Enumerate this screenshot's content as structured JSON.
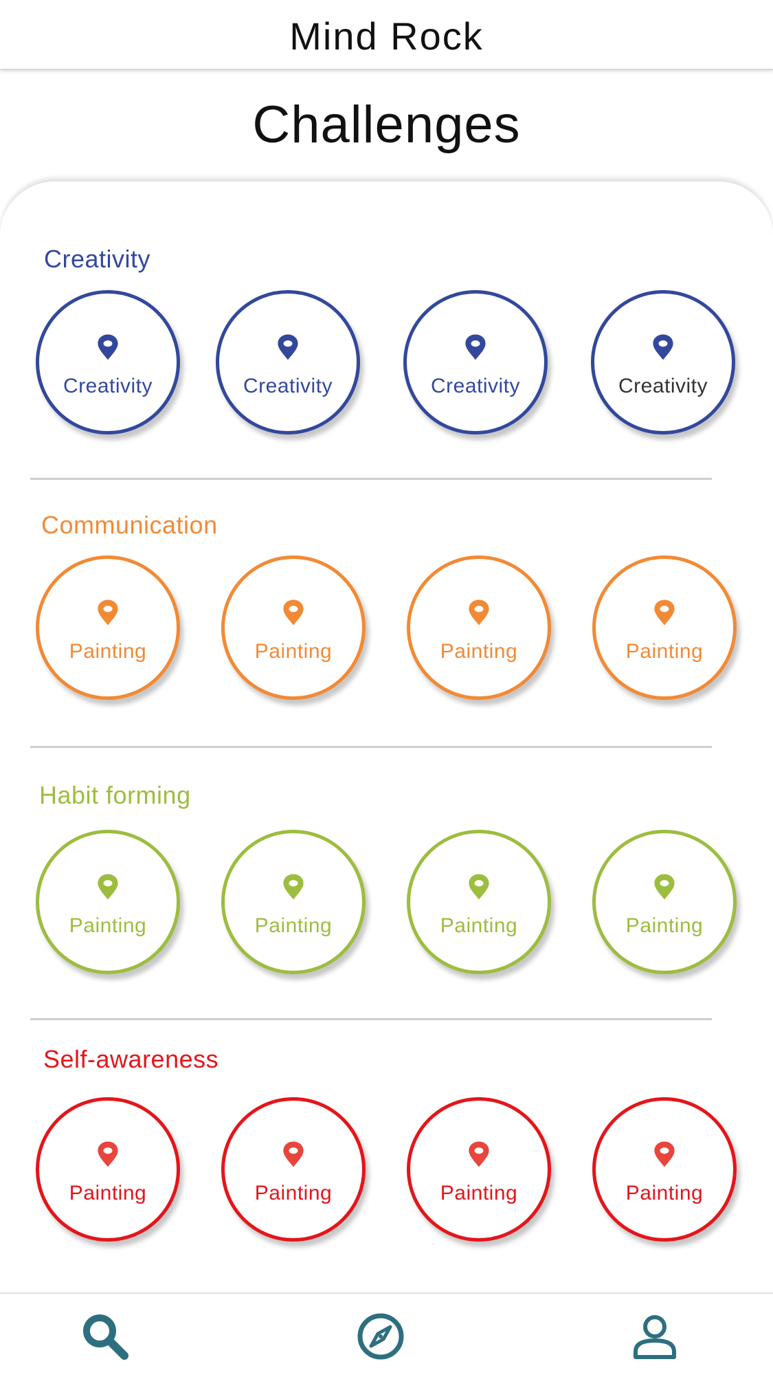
{
  "header": {
    "title": "Mind Rock"
  },
  "page": {
    "title": "Challenges"
  },
  "colors": {
    "creativity": "#33489c",
    "communication": "#f28a35",
    "habit": "#9dbd3f",
    "self": "#e3161b",
    "nav": "#2e6f7f"
  },
  "sections": [
    {
      "title": "Creativity",
      "color": "#33489c",
      "items": [
        {
          "label": "Creativity",
          "icon": "pin-icon"
        },
        {
          "label": "Creativity",
          "icon": "pin-icon"
        },
        {
          "label": "Creativity",
          "icon": "pin-icon"
        },
        {
          "label": "Creativity",
          "icon": "pin-icon",
          "label_color": "#333333"
        }
      ]
    },
    {
      "title": "Communication",
      "color": "#f28a35",
      "items": [
        {
          "label": "Painting",
          "icon": "pin-icon"
        },
        {
          "label": "Painting",
          "icon": "pin-icon"
        },
        {
          "label": "Painting",
          "icon": "pin-icon"
        },
        {
          "label": "Painting",
          "icon": "pin-icon"
        }
      ]
    },
    {
      "title": "Habit forming",
      "color": "#9dbd3f",
      "items": [
        {
          "label": "Painting",
          "icon": "pin-icon"
        },
        {
          "label": "Painting",
          "icon": "pin-icon"
        },
        {
          "label": "Painting",
          "icon": "pin-icon"
        },
        {
          "label": "Painting",
          "icon": "pin-icon"
        }
      ]
    },
    {
      "title": "Self-awareness",
      "color": "#e3161b",
      "items": [
        {
          "label": "Painting",
          "icon": "pin-icon"
        },
        {
          "label": "Painting",
          "icon": "pin-icon"
        },
        {
          "label": "Painting",
          "icon": "pin-icon"
        },
        {
          "label": "Painting",
          "icon": "pin-icon"
        }
      ]
    }
  ],
  "bottom_nav": [
    {
      "icon": "search-icon"
    },
    {
      "icon": "compass-icon"
    },
    {
      "icon": "profile-icon"
    }
  ]
}
